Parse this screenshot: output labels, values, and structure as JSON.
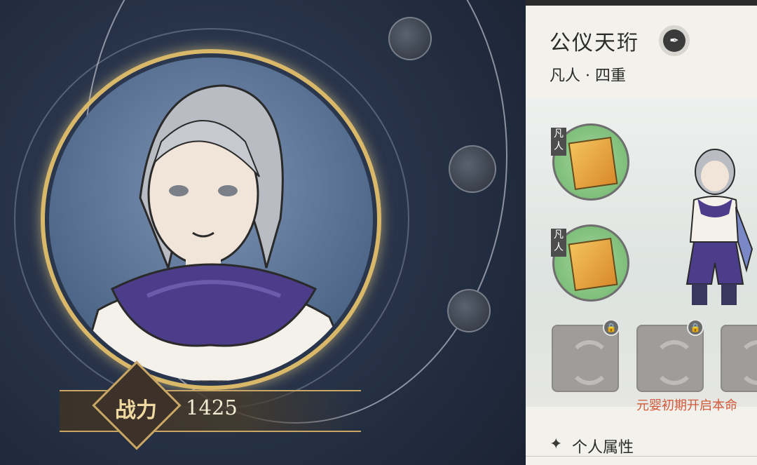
{
  "character": {
    "name": "公仪天珩",
    "realm": "凡人 · 四重",
    "badge_icon": "realm-emblem-icon"
  },
  "combat_power": {
    "label": "战力",
    "value": "1425"
  },
  "skills": [
    {
      "tag": "凡人",
      "icon": "golden-book-icon"
    },
    {
      "tag": "凡人",
      "icon": "golden-book-icon"
    }
  ],
  "locked_slots": {
    "icon": "cloud-swirl-icon",
    "lock_icon": "lock-icon",
    "unlock_hint": "元婴初期开启本命"
  },
  "sections": {
    "personal_attributes": "个人属性"
  },
  "colors": {
    "gold_accent": "#d9b86a",
    "panel_bg": "#f2f1ec",
    "hint_red": "#d35a3a",
    "skill_green": "#6cb36a"
  }
}
